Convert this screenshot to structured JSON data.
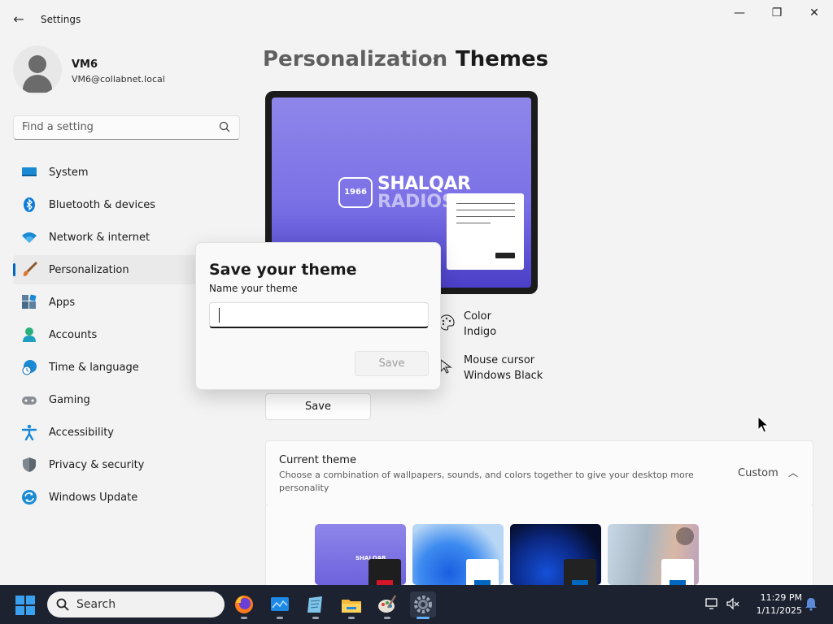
{
  "window": {
    "title": "Settings",
    "back_label": "←",
    "minimize": "—",
    "maximize": "❐",
    "close": "✕"
  },
  "profile": {
    "name": "VM6",
    "email": "VM6@collabnet.local"
  },
  "search": {
    "placeholder": "Find a setting"
  },
  "sidebar": {
    "items": [
      {
        "label": "System",
        "icon": "system-icon",
        "selected": false
      },
      {
        "label": "Bluetooth & devices",
        "icon": "bluetooth-icon",
        "selected": false
      },
      {
        "label": "Network & internet",
        "icon": "wifi-icon",
        "selected": false
      },
      {
        "label": "Personalization",
        "icon": "brush-icon",
        "selected": true
      },
      {
        "label": "Apps",
        "icon": "apps-icon",
        "selected": false
      },
      {
        "label": "Accounts",
        "icon": "accounts-icon",
        "selected": false
      },
      {
        "label": "Time & language",
        "icon": "clock-globe-icon",
        "selected": false
      },
      {
        "label": "Gaming",
        "icon": "gamepad-icon",
        "selected": false
      },
      {
        "label": "Accessibility",
        "icon": "accessibility-icon",
        "selected": false
      },
      {
        "label": "Privacy & security",
        "icon": "shield-icon",
        "selected": false
      },
      {
        "label": "Windows Update",
        "icon": "update-icon",
        "selected": false
      }
    ]
  },
  "header": {
    "parent": "Personalization",
    "separator": "›",
    "current": "Themes"
  },
  "preview": {
    "logo_year": "1966",
    "logo_line1": "SHALQAR",
    "logo_line2": "RADIOS"
  },
  "properties": {
    "color_label": "Color",
    "color_value": "Indigo",
    "cursor_label": "Mouse cursor",
    "cursor_value": "Windows Black"
  },
  "save_button": "Save",
  "current_theme": {
    "title": "Current theme",
    "description": "Choose a combination of wallpapers, sounds, and colors together to give your desktop more personality",
    "value": "Custom",
    "chevron": "︿"
  },
  "dialog": {
    "title": "Save your theme",
    "subtitle": "Name your theme",
    "input_value": "",
    "save_label": "Save"
  },
  "taskbar": {
    "search_label": "Search",
    "time": "11:29 PM",
    "date": "1/11/2025",
    "apps": [
      "firefox-icon",
      "monitor-app-icon",
      "notepad-app-icon",
      "file-explorer-icon",
      "paint-app-icon",
      "settings-gear-icon"
    ]
  },
  "colors": {
    "accent": "#0067c0",
    "indigo_wallpaper": "#7b71e6",
    "taskbar": "#1c2230"
  }
}
